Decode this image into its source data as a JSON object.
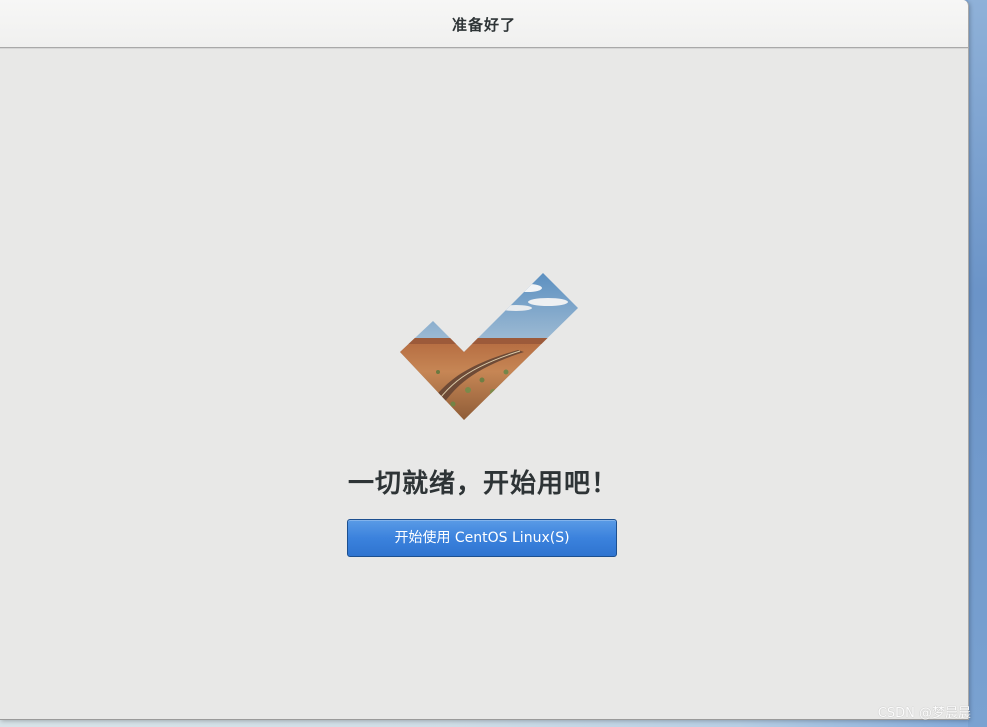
{
  "window": {
    "title": "准备好了"
  },
  "main": {
    "heading": "一切就绪，开始用吧！",
    "start_button_label": "开始使用 CentOS Linux(S)",
    "graphic_icon": "checkmark-landscape-icon"
  },
  "overlay": {
    "watermark": "CSDN @梦晨晨"
  },
  "colors": {
    "window_background": "#e8e8e7",
    "header_background": "#f4f4f3",
    "heading_text": "#2e3436",
    "button_blue": "#3b82dd",
    "button_border": "#1c4f8f"
  }
}
